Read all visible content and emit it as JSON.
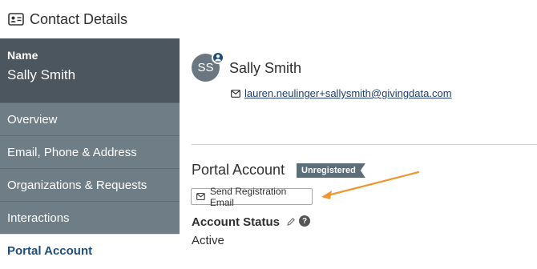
{
  "header": {
    "title": "Contact Details",
    "icon": "contact-card-icon"
  },
  "sidebar": {
    "name_label": "Name",
    "name_value": "Sally Smith",
    "items": [
      {
        "label": "Overview",
        "active": false
      },
      {
        "label": "Email, Phone & Address",
        "active": false
      },
      {
        "label": "Organizations & Requests",
        "active": false
      },
      {
        "label": "Interactions",
        "active": false
      },
      {
        "label": "Portal Account",
        "active": true
      }
    ]
  },
  "contact": {
    "initials": "SS",
    "name": "Sally Smith",
    "email": "lauren.neulinger+sallysmith@givingdata.com"
  },
  "portal": {
    "title": "Portal Account",
    "badge": "Unregistered",
    "send_button_label": "Send Registration Email",
    "status_label": "Account Status",
    "status_value": "Active",
    "help_glyph": "?"
  },
  "colors": {
    "sidebar_dark": "#4b565e",
    "sidebar_item": "#6f7d86",
    "active_text": "#1f4e78",
    "badge_bg": "#5d6e7b",
    "arrow": "#f0962e"
  }
}
